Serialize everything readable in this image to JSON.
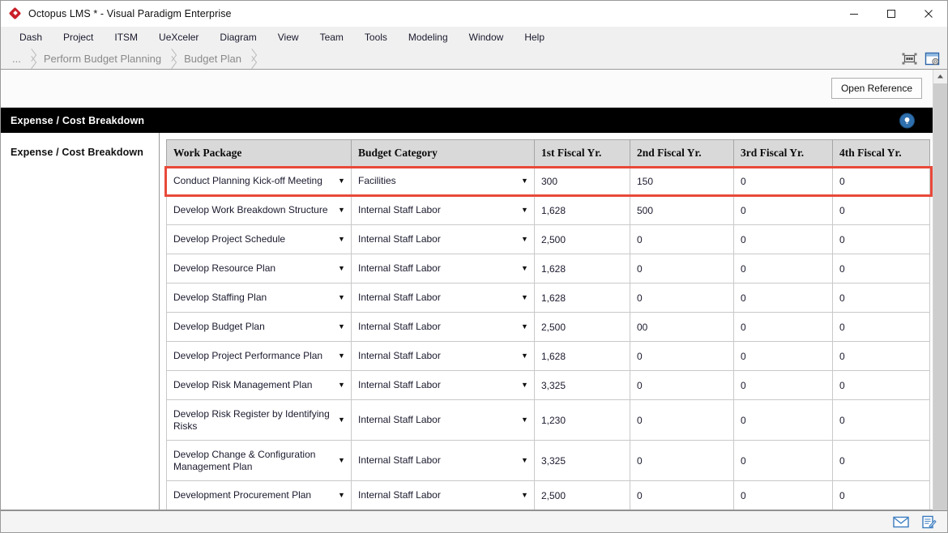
{
  "window": {
    "title": "Octopus LMS * - Visual Paradigm Enterprise",
    "logo_icon": "red-diamond-logo",
    "minimize_label": "minimize-icon",
    "maximize_label": "maximize-icon",
    "close_label": "close-icon"
  },
  "menu": {
    "items": [
      {
        "label": "Dash"
      },
      {
        "label": "Project"
      },
      {
        "label": "ITSM"
      },
      {
        "label": "UeXceler"
      },
      {
        "label": "Diagram"
      },
      {
        "label": "View"
      },
      {
        "label": "Team"
      },
      {
        "label": "Tools"
      },
      {
        "label": "Modeling"
      },
      {
        "label": "Window"
      },
      {
        "label": "Help"
      }
    ]
  },
  "breadcrumb": {
    "items": [
      {
        "label": "..."
      },
      {
        "label": "Perform Budget Planning"
      },
      {
        "label": "Budget Plan"
      }
    ],
    "tools": [
      {
        "icon": "fit-to-screen-icon"
      },
      {
        "icon": "form-window-icon"
      }
    ]
  },
  "toolbar": {
    "open_reference_label": "Open Reference"
  },
  "section": {
    "header_title": "Expense / Cost Breakdown",
    "badge_icon": "lightbulb-icon",
    "left_panel_label": "Expense / Cost Breakdown"
  },
  "table": {
    "columns": [
      "Work Package",
      "Budget Category",
      "1st Fiscal Yr.",
      "2nd Fiscal Yr.",
      "3rd Fiscal Yr.",
      "4th Fiscal Yr."
    ],
    "rows": [
      {
        "work_package": "Conduct Planning Kick-off Meeting",
        "budget_category": "Facilities",
        "fy1": "300",
        "fy2": "150",
        "fy3": "0",
        "fy4": "0",
        "highlighted": true
      },
      {
        "work_package": "Develop Work Breakdown Structure",
        "budget_category": "Internal Staff Labor",
        "fy1": "1,628",
        "fy2": "500",
        "fy3": "0",
        "fy4": "0",
        "highlighted": false
      },
      {
        "work_package": "Develop Project Schedule",
        "budget_category": "Internal Staff Labor",
        "fy1": "2,500",
        "fy2": "0",
        "fy3": "0",
        "fy4": "0",
        "highlighted": false
      },
      {
        "work_package": "Develop Resource Plan",
        "budget_category": "Internal Staff Labor",
        "fy1": "1,628",
        "fy2": "0",
        "fy3": "0",
        "fy4": "0",
        "highlighted": false
      },
      {
        "work_package": "Develop Staffing Plan",
        "budget_category": "Internal Staff Labor",
        "fy1": "1,628",
        "fy2": "0",
        "fy3": "0",
        "fy4": "0",
        "highlighted": false
      },
      {
        "work_package": "Develop Budget Plan",
        "budget_category": "Internal Staff Labor",
        "fy1": "2,500",
        "fy2": "00",
        "fy3": "0",
        "fy4": "0",
        "highlighted": false
      },
      {
        "work_package": "Develop Project Performance Plan",
        "budget_category": "Internal Staff Labor",
        "fy1": "1,628",
        "fy2": "0",
        "fy3": "0",
        "fy4": "0",
        "highlighted": false
      },
      {
        "work_package": "Develop Risk Management Plan",
        "budget_category": "Internal Staff Labor",
        "fy1": "3,325",
        "fy2": "0",
        "fy3": "0",
        "fy4": "0",
        "highlighted": false
      },
      {
        "work_package": "Develop Risk Register by Identifying Risks",
        "budget_category": "Internal Staff Labor",
        "fy1": "1,230",
        "fy2": "0",
        "fy3": "0",
        "fy4": "0",
        "highlighted": false,
        "tall": true
      },
      {
        "work_package": "Develop Change & Configuration Management Plan",
        "budget_category": "Internal Staff Labor",
        "fy1": "3,325",
        "fy2": "0",
        "fy3": "0",
        "fy4": "0",
        "highlighted": false,
        "tall": true
      },
      {
        "work_package": "Development Procurement Plan",
        "budget_category": "Internal Staff Labor",
        "fy1": "2,500",
        "fy2": "0",
        "fy3": "0",
        "fy4": "0",
        "highlighted": false
      }
    ],
    "dropdown_arrow": "▼"
  },
  "statusbar": {
    "icons": [
      {
        "icon": "mail-envelope-icon"
      },
      {
        "icon": "note-edit-icon"
      }
    ]
  },
  "colors": {
    "highlight_red": "#e8493a",
    "header_black": "#000000",
    "badge_blue": "#2f6fad",
    "logo_red": "#c9202a"
  }
}
